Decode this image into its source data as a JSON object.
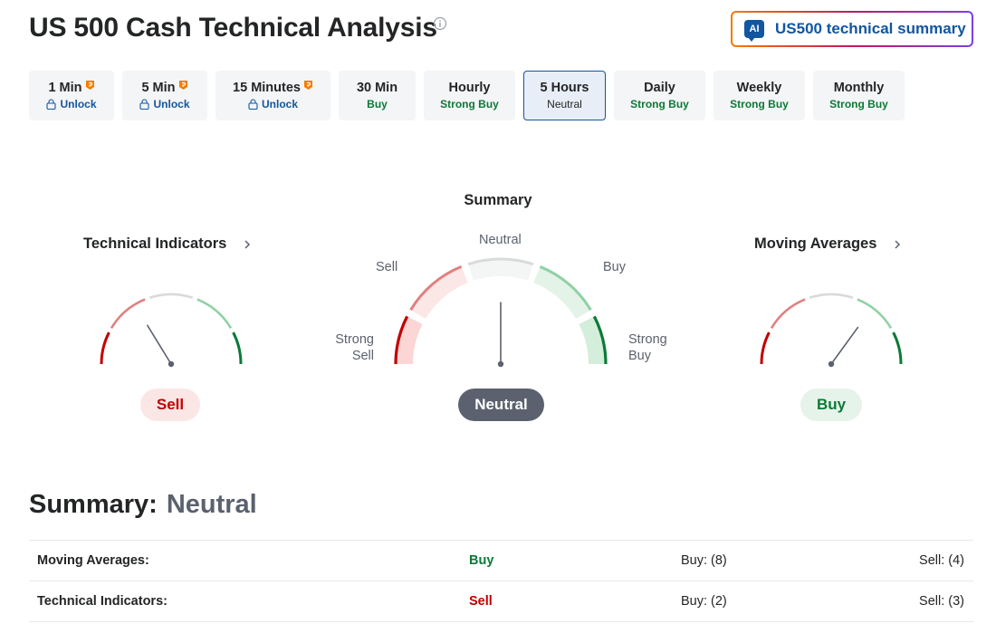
{
  "header": {
    "title": "US 500 Cash Technical Analysis",
    "ai_button_badge": "AI",
    "ai_button_label": "US500 technical summary"
  },
  "tabs": [
    {
      "label": "1 Min",
      "signal": "Unlock",
      "pro": true,
      "locked": true
    },
    {
      "label": "5 Min",
      "signal": "Unlock",
      "pro": true,
      "locked": true
    },
    {
      "label": "15 Minutes",
      "signal": "Unlock",
      "pro": true,
      "locked": true
    },
    {
      "label": "30 Min",
      "signal": "Buy",
      "pro": false,
      "locked": false
    },
    {
      "label": "Hourly",
      "signal": "Strong Buy",
      "pro": false,
      "locked": false
    },
    {
      "label": "5 Hours",
      "signal": "Neutral",
      "pro": false,
      "locked": false,
      "active": true
    },
    {
      "label": "Daily",
      "signal": "Strong Buy",
      "pro": false,
      "locked": false
    },
    {
      "label": "Weekly",
      "signal": "Strong Buy",
      "pro": false,
      "locked": false
    },
    {
      "label": "Monthly",
      "signal": "Strong Buy",
      "pro": false,
      "locked": false
    }
  ],
  "summary_heading": "Summary",
  "gauges": {
    "technical_indicators": {
      "title": "Technical Indicators",
      "result": "Sell",
      "needle_value": -0.35
    },
    "summary": {
      "result": "Neutral",
      "needle_value": 0,
      "labels": {
        "strong_sell": "Strong\nSell",
        "sell": "Sell",
        "neutral": "Neutral",
        "buy": "Buy",
        "strong_buy": "Strong\nBuy"
      }
    },
    "moving_averages": {
      "title": "Moving Averages",
      "result": "Buy",
      "needle_value": 0.4
    }
  },
  "bottom_summary": {
    "label": "Summary:",
    "value": "Neutral"
  },
  "table": [
    {
      "name": "Moving Averages:",
      "signal": "Buy",
      "buy": "Buy: (8)",
      "sell": "Sell: (4)"
    },
    {
      "name": "Technical Indicators:",
      "signal": "Sell",
      "buy": "Buy: (2)",
      "sell": "Sell: (3)"
    }
  ],
  "colors": {
    "strong_sell": "#c20000",
    "sell": "#e08080",
    "neutral": "#d9dadb",
    "buy": "#8fd1a5",
    "strong_buy": "#0b7a36",
    "link_blue": "#1256a0"
  }
}
